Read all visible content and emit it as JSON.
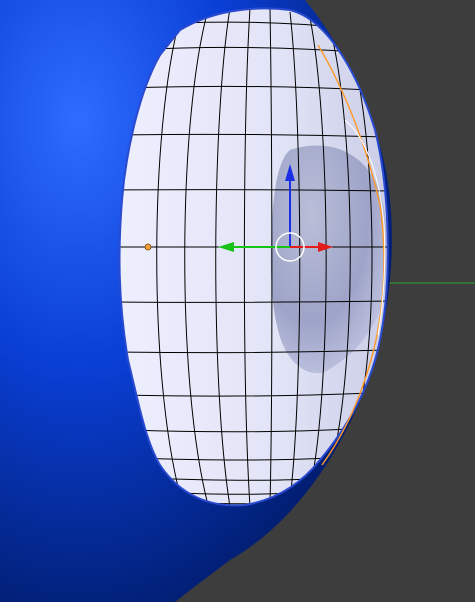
{
  "viewport": {
    "background": "#3d3d3d",
    "object": {
      "shell_color": "#0a3fd6",
      "shell_dark": "#001a66",
      "mesh_color": "#eef0ff",
      "mesh_shadow": "#9ea4c8",
      "wire_color": "#000000",
      "edge_highlight": "#ff9a2a",
      "vertex_color": "#f3a13a"
    },
    "gizmo": {
      "x_axis_color": "#e21b1b",
      "y_axis_color": "#17c317",
      "z_axis_color": "#1a2ee6",
      "center_ring_color": "#ffffff"
    },
    "y_axis_line_color": "#2f8f2f"
  }
}
